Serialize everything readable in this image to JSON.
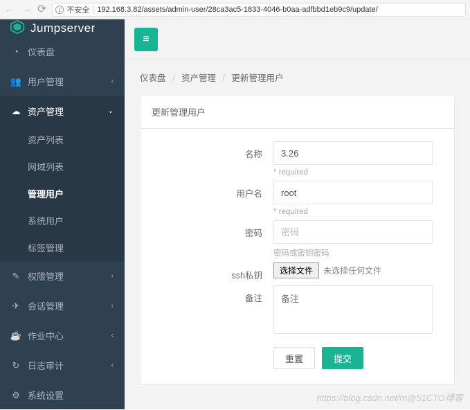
{
  "browser": {
    "unsafe_label": "不安全",
    "url": "192.168.3.82/assets/admin-user/28ca3ac5-1833-4046-b0aa-adfbbd1eb9c9/update/"
  },
  "brand": "Jumpserver",
  "sidebar": [
    {
      "icon": "dashboard-icon",
      "label": "仪表盘",
      "expandable": false
    },
    {
      "icon": "users-icon",
      "label": "用户管理",
      "expandable": true
    },
    {
      "icon": "cloud-icon",
      "label": "资产管理",
      "expandable": true,
      "active": true,
      "children": [
        {
          "label": "资产列表"
        },
        {
          "label": "网域列表"
        },
        {
          "label": "管理用户",
          "active": true
        },
        {
          "label": "系统用户"
        },
        {
          "label": "标签管理"
        }
      ]
    },
    {
      "icon": "edit-icon",
      "label": "权限管理",
      "expandable": true
    },
    {
      "icon": "plane-icon",
      "label": "会话管理",
      "expandable": true
    },
    {
      "icon": "coffee-icon",
      "label": "作业中心",
      "expandable": true
    },
    {
      "icon": "history-icon",
      "label": "日志审计",
      "expandable": true
    },
    {
      "icon": "gear-icon",
      "label": "系统设置",
      "expandable": false
    }
  ],
  "breadcrumb": {
    "root": "仪表盘",
    "mid": "资产管理",
    "current": "更新管理用户"
  },
  "panel": {
    "title": "更新管理用户"
  },
  "form": {
    "name": {
      "label": "名称",
      "value": "3.26",
      "hint": "* required"
    },
    "username": {
      "label": "用户名",
      "value": "root",
      "hint": "* required"
    },
    "password": {
      "label": "密码",
      "placeholder": "密码",
      "hint": "密码或密钥密码"
    },
    "ssh_key": {
      "label": "ssh私钥",
      "button": "选择文件",
      "status": "未选择任何文件"
    },
    "comment": {
      "label": "备注",
      "placeholder": "备注"
    },
    "reset": "重置",
    "submit": "提交"
  },
  "watermark": "https://blog.csdn.net/m@51CTO博客"
}
